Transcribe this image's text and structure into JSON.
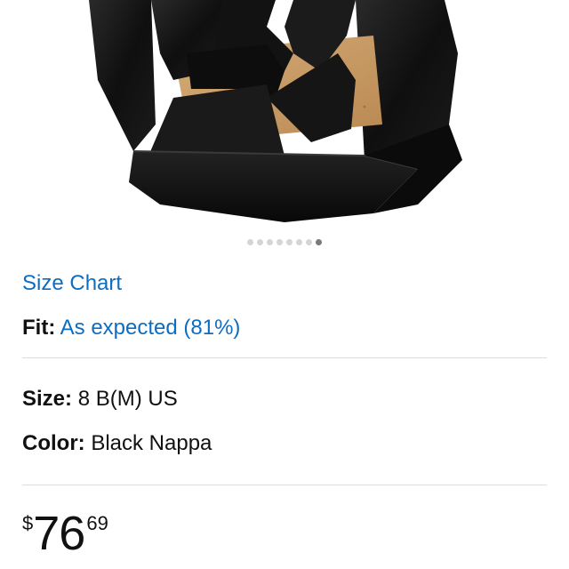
{
  "product": {
    "image_alt": "Black wedge sandal",
    "carousel": {
      "total": 8,
      "active_index": 7
    }
  },
  "size_chart_label": "Size Chart",
  "fit": {
    "label": "Fit:",
    "value": "As expected (81%)"
  },
  "size": {
    "label": "Size:",
    "value": "8 B(M) US"
  },
  "color": {
    "label": "Color:",
    "value": "Black Nappa"
  },
  "price": {
    "currency": "$",
    "whole": "76",
    "fraction": "69"
  },
  "colors": {
    "link": "#0f6dbf",
    "shoe": "#141414",
    "cork": "#c99a63"
  }
}
